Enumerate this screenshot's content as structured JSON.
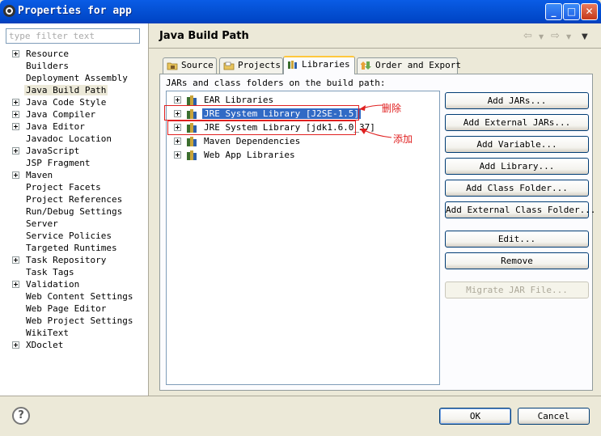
{
  "window": {
    "title": "Properties for app",
    "controls": {
      "minimize": "_",
      "maximize": "□",
      "close": "✕"
    }
  },
  "left": {
    "filter_placeholder": "type filter text",
    "tree": [
      {
        "label": "Resource",
        "expandable": true
      },
      {
        "label": "Builders",
        "expandable": false
      },
      {
        "label": "Deployment Assembly",
        "expandable": false
      },
      {
        "label": "Java Build Path",
        "expandable": false,
        "selected": true
      },
      {
        "label": "Java Code Style",
        "expandable": true
      },
      {
        "label": "Java Compiler",
        "expandable": true
      },
      {
        "label": "Java Editor",
        "expandable": true
      },
      {
        "label": "Javadoc Location",
        "expandable": false
      },
      {
        "label": "JavaScript",
        "expandable": true
      },
      {
        "label": "JSP Fragment",
        "expandable": false
      },
      {
        "label": "Maven",
        "expandable": true
      },
      {
        "label": "Project Facets",
        "expandable": false
      },
      {
        "label": "Project References",
        "expandable": false
      },
      {
        "label": "Run/Debug Settings",
        "expandable": false
      },
      {
        "label": "Server",
        "expandable": false
      },
      {
        "label": "Service Policies",
        "expandable": false
      },
      {
        "label": "Targeted Runtimes",
        "expandable": false
      },
      {
        "label": "Task Repository",
        "expandable": true
      },
      {
        "label": "Task Tags",
        "expandable": false
      },
      {
        "label": "Validation",
        "expandable": true
      },
      {
        "label": "Web Content Settings",
        "expandable": false
      },
      {
        "label": "Web Page Editor",
        "expandable": false
      },
      {
        "label": "Web Project Settings",
        "expandable": false
      },
      {
        "label": "WikiText",
        "expandable": false
      },
      {
        "label": "XDoclet",
        "expandable": true
      }
    ]
  },
  "main": {
    "title": "Java Build Path",
    "tabs": [
      {
        "label": "Source",
        "active": false
      },
      {
        "label": "Projects",
        "active": false
      },
      {
        "label": "Libraries",
        "active": true
      },
      {
        "label": "Order and Export",
        "active": false
      }
    ],
    "caption": "JARs and class folders on the build path:",
    "libraries": [
      {
        "label": "EAR Libraries",
        "selected": false
      },
      {
        "label": "JRE System Library [J2SE-1.5]",
        "selected": true
      },
      {
        "label": "JRE System Library [jdk1.6.0_37]",
        "selected": false
      },
      {
        "label": "Maven Dependencies",
        "selected": false
      },
      {
        "label": "Web App Libraries",
        "selected": false
      }
    ],
    "annotations": {
      "delete": "删除",
      "add": "添加"
    },
    "buttons": [
      {
        "label": "Add JARs...",
        "enabled": true
      },
      {
        "label": "Add External JARs...",
        "enabled": true
      },
      {
        "label": "Add Variable...",
        "enabled": true
      },
      {
        "label": "Add Library...",
        "enabled": true
      },
      {
        "label": "Add Class Folder...",
        "enabled": true
      },
      {
        "label": "Add External Class Folder...",
        "enabled": true
      },
      {
        "label": "Edit...",
        "enabled": true
      },
      {
        "label": "Remove",
        "enabled": true
      },
      {
        "label": "Migrate JAR File...",
        "enabled": false
      }
    ]
  },
  "footer": {
    "help": "?",
    "ok": "OK",
    "cancel": "Cancel"
  },
  "colors": {
    "selection": "#316ac5",
    "annotation": "#e02020",
    "titlebar": "#0552d6"
  }
}
